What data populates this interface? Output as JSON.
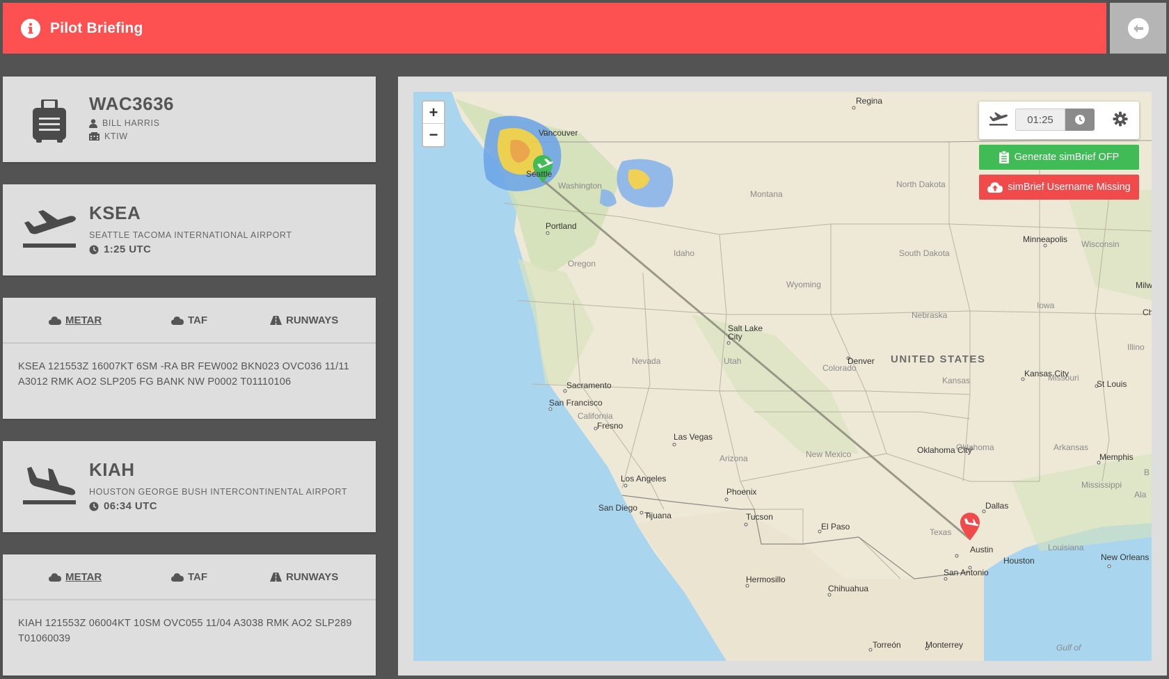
{
  "header": {
    "title": "Pilot Briefing"
  },
  "flight": {
    "callsign": "WAC3636",
    "pilot": "BILL HARRIS",
    "company": "KTIW"
  },
  "departure": {
    "icao": "KSEA",
    "name": "SEATTLE TACOMA INTERNATIONAL AIRPORT",
    "time": "1:25 UTC"
  },
  "arrival": {
    "icao": "KIAH",
    "name": "HOUSTON GEORGE BUSH INTERCONTINENTAL AIRPORT",
    "time": "06:34 UTC"
  },
  "tabs": {
    "metar": "METAR",
    "taf": "TAF",
    "runways": "RUNWAYS"
  },
  "dep_weather": {
    "metar": "KSEA 121553Z 16007KT 6SM -RA BR FEW002 BKN023 OVC036 11/11 A3012 RMK AO2 SLP205 FG BANK NW P0002 T01110106"
  },
  "arr_weather": {
    "metar": "KIAH 121553Z 06004KT 10SM OVC055 11/04 A3038 RMK AO2 SLP289 T01060039"
  },
  "map": {
    "zoom_in": "+",
    "zoom_out": "−",
    "time_value": "01:25",
    "generate_ofp": "Generate simBrief OFP",
    "username_missing": "simBrief Username Missing",
    "colors": {
      "route": "#8a8a7a",
      "dep_marker": "#41bb55",
      "arr_marker": "#f04a4a"
    },
    "cities": {
      "regina": "Regina",
      "vancouver": "Vancouver",
      "seattle": "Seattle",
      "portland": "Portland",
      "minneapolis": "Minneapolis",
      "saltlake": "Salt Lake City",
      "denver": "Denver",
      "kansascity": "Kansas City",
      "stlouis": "St Louis",
      "sacramento": "Sacramento",
      "sanfrancisco": "San Francisco",
      "fresno": "Fresno",
      "lasvegas": "Las Vegas",
      "losangeles": "Los Angeles",
      "phoenix": "Phoenix",
      "sandiego": "San Diego",
      "tijuana": "Tijuana",
      "tucson": "Tucson",
      "elpaso": "El Paso",
      "oklahomacity": "Oklahoma City",
      "memphis": "Memphis",
      "dallas": "Dallas",
      "austin": "Austin",
      "houston": "Houston",
      "sanantonio": "San Antonio",
      "neworleans": "New Orleans",
      "hermosillo": "Hermosillo",
      "chihuahua": "Chihuahua",
      "torreon": "Torreón",
      "monterrey": "Monterrey",
      "milwaukee": "Milwau",
      "chi": "Ch"
    },
    "states": {
      "washington": "Washington",
      "montana": "Montana",
      "northdakota": "North Dakota",
      "southdakota": "South Dakota",
      "wisconsin": "Wisconsin",
      "oregon": "Oregon",
      "idaho": "Idaho",
      "wyoming": "Wyoming",
      "iowa": "Iowa",
      "nebraska": "Nebraska",
      "illinois": "Illino",
      "nevada": "Nevada",
      "utah": "Utah",
      "colorado": "Colorado",
      "kansas": "Kansas",
      "missouri": "Missouri",
      "california": "California",
      "arizona": "Arizona",
      "newmexico": "New Mexico",
      "oklahoma": "Oklahoma",
      "arkansas": "Arkansas",
      "mississippi": "Mississippi",
      "alabama": "Ala",
      "texas": "Texas",
      "louisiana": "Louisiana",
      "b": "B",
      "gulf": "Gulf of"
    },
    "country": "UNITED STATES"
  }
}
